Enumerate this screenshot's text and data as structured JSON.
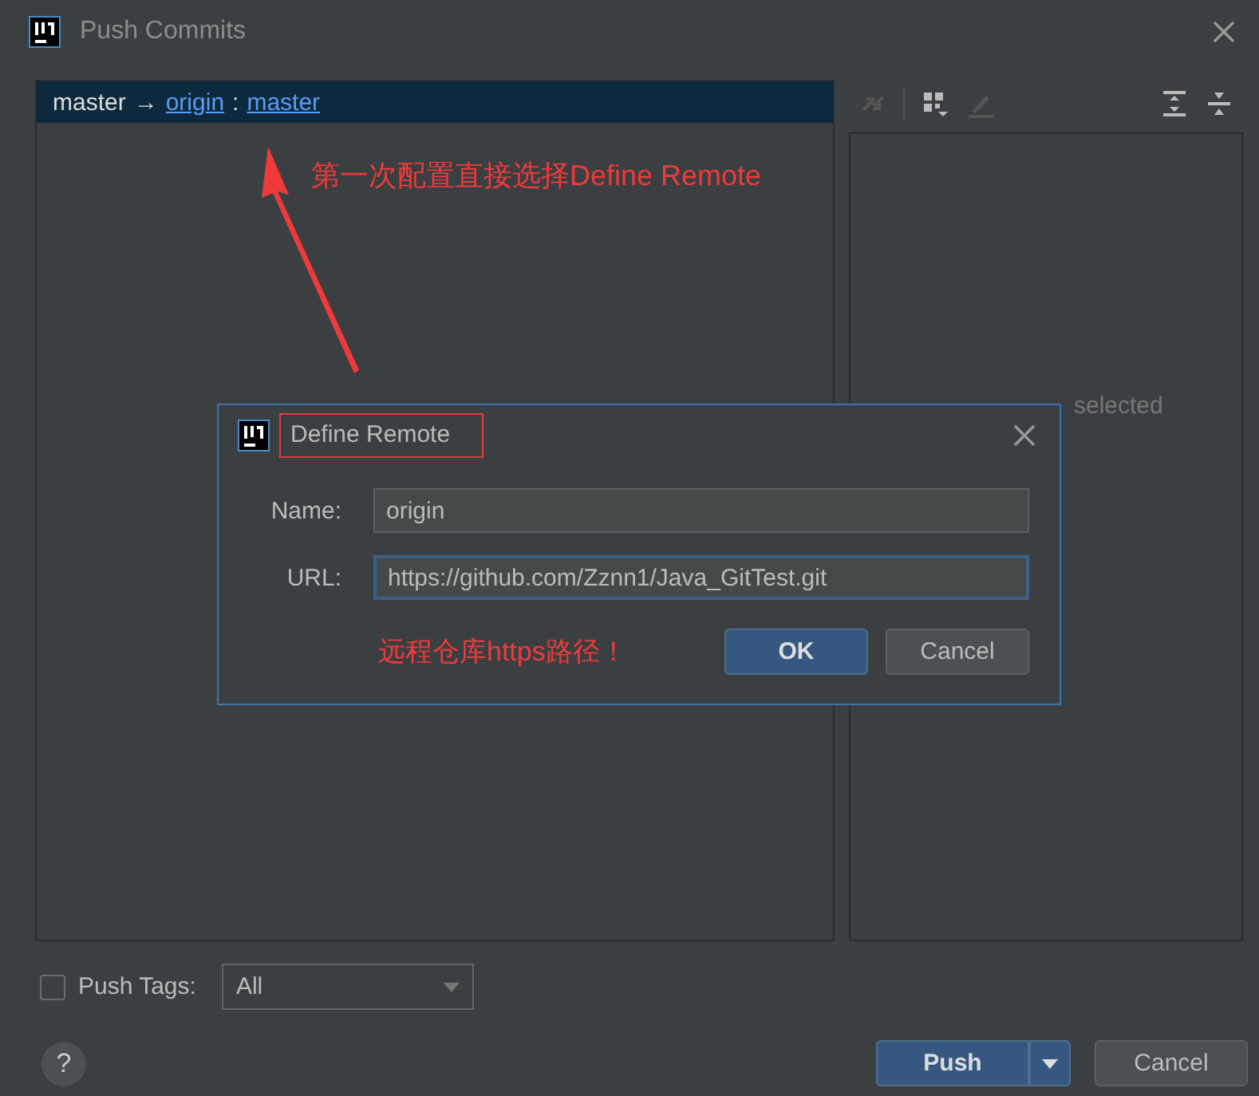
{
  "window": {
    "title": "Push Commits"
  },
  "branch": {
    "source": "master",
    "arrow": "→",
    "remote": "origin",
    "separator": ":",
    "target": "master"
  },
  "details": {
    "empty_text": "selected"
  },
  "push_tags": {
    "label": "Push Tags:",
    "checked": false,
    "option": "All"
  },
  "buttons": [
    {
      "label": "?",
      "kind": "help"
    },
    {
      "label": "Push",
      "kind": "primary"
    },
    {
      "label": "Cancel",
      "kind": "plain"
    }
  ],
  "define_remote": {
    "title": "Define Remote",
    "fields": [
      {
        "label": "Name:",
        "value": "origin",
        "focused": false
      },
      {
        "label": "URL:",
        "value": "https://github.com/Zznn1/Java_GitTest.git",
        "focused": true
      }
    ],
    "buttons": [
      {
        "label": "OK",
        "kind": "primary"
      },
      {
        "label": "Cancel",
        "kind": "plain"
      }
    ]
  },
  "annotations": [
    {
      "text": "第一次配置直接选择Define Remote"
    },
    {
      "text": "远程仓库https路径！"
    }
  ]
}
